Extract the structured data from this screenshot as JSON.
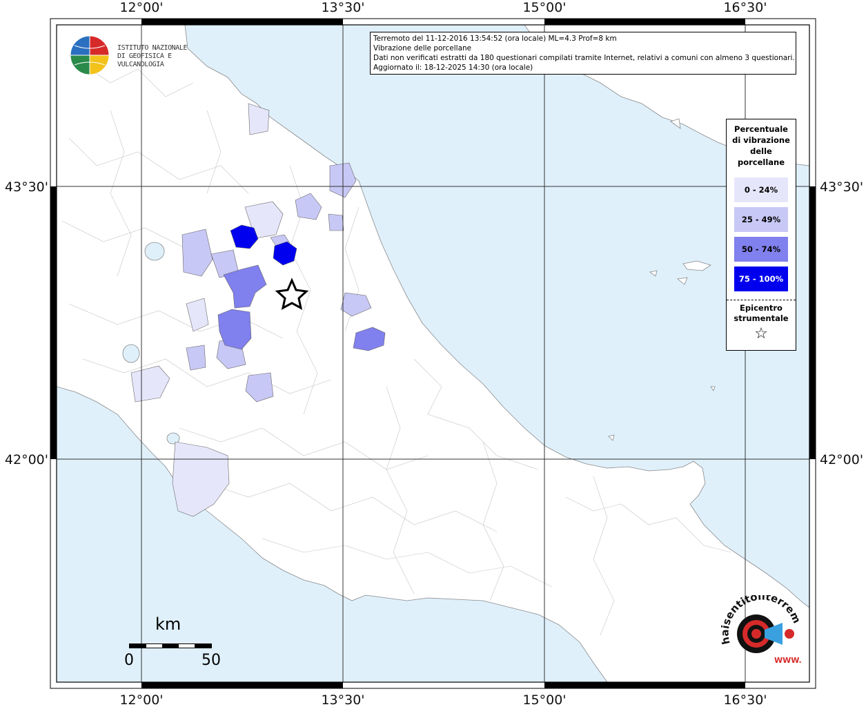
{
  "info": {
    "line1": "Terremoto del 11-12-2016 13:54:52 (ora locale) ML=4.3 Prof=8 km",
    "line2": "Vibrazione delle porcellane",
    "line3": "Dati non verificati estratti da 180 questionari compilati tramite Internet, relativi a comuni con almeno 3 questionari.",
    "line4": "Aggiornato il: 18-12-2025 14:30 (ora locale)"
  },
  "institute": {
    "line1": "ISTITUTO NAZIONALE",
    "line2": "DI GEOFISICA E VULCANOLOGIA"
  },
  "axes": {
    "top": [
      "12°00'",
      "13°30'",
      "15°00'",
      "16°30'"
    ],
    "bottom": [
      "12°00'",
      "13°30'",
      "15°00'",
      "16°30'"
    ],
    "left": [
      "43°30'",
      "42°00'"
    ],
    "right": [
      "43°30'",
      "42°00'"
    ]
  },
  "legend": {
    "title_lines": [
      "Percentuale",
      "di vibrazione",
      "delle",
      "porcellane"
    ],
    "classes": [
      {
        "label": "0 - 24%",
        "color": "#e6e6fb",
        "text_color": "#000000"
      },
      {
        "label": "25 - 49%",
        "color": "#c8c8f6",
        "text_color": "#000000"
      },
      {
        "label": "50 - 74%",
        "color": "#8080ee",
        "text_color": "#000000"
      },
      {
        "label": "75 - 100%",
        "color": "#0000ee",
        "text_color": "#ffffff"
      }
    ],
    "epicenter_lines": [
      "Epicentro",
      "strumentale"
    ],
    "epicenter_symbol": "☆"
  },
  "scale": {
    "unit": "km",
    "min": "0",
    "max": "50"
  },
  "logo": {
    "text": "haisentitoilterremoto.it",
    "sub": "WWW."
  },
  "colors": {
    "sea": "#dff0fb",
    "land": "#ffffff",
    "borders": "#b8b8b8",
    "frame": "#000000"
  }
}
